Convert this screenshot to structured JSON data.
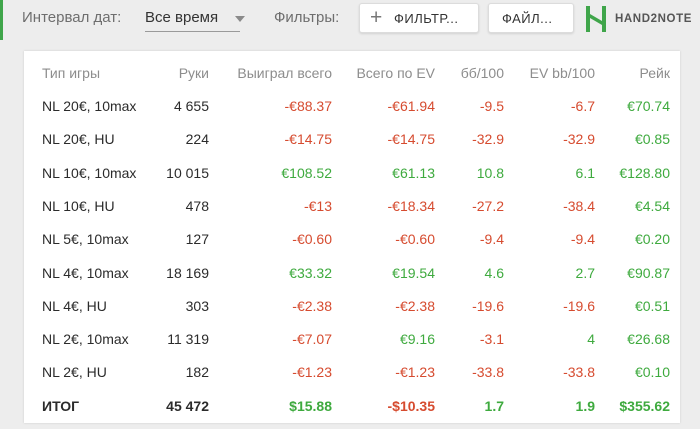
{
  "topbar": {
    "interval_label": "Интервал дат:",
    "interval_value": "Все время",
    "filters_label": "Фильтры:",
    "filter_button": "ФИЛЬТР...",
    "file_button": "ФАЙЛ...",
    "logo_text": "HAND2NOTE"
  },
  "table": {
    "headers": [
      "Тип игры",
      "Руки",
      "Выиграл всего",
      "Всего по EV",
      "бб/100",
      "EV bb/100",
      "Рейк"
    ],
    "rows": [
      [
        "NL 20€, 10max",
        "4 655",
        "-€88.37",
        "-€61.94",
        "-9.5",
        "-6.7",
        "€70.74"
      ],
      [
        "NL 20€, HU",
        "224",
        "-€14.75",
        "-€14.75",
        "-32.9",
        "-32.9",
        "€0.85"
      ],
      [
        "NL 10€, 10max",
        "10 015",
        "€108.52",
        "€61.13",
        "10.8",
        "6.1",
        "€128.80"
      ],
      [
        "NL 10€, HU",
        "478",
        "-€13",
        "-€18.34",
        "-27.2",
        "-38.4",
        "€4.54"
      ],
      [
        "NL 5€, 10max",
        "127",
        "-€0.60",
        "-€0.60",
        "-9.4",
        "-9.4",
        "€0.20"
      ],
      [
        "NL 4€, 10max",
        "18 169",
        "€33.32",
        "€19.54",
        "4.6",
        "2.7",
        "€90.87"
      ],
      [
        "NL 4€, HU",
        "303",
        "-€2.38",
        "-€2.38",
        "-19.6",
        "-19.6",
        "€0.51"
      ],
      [
        "NL 2€, 10max",
        "11 319",
        "-€7.07",
        "€9.16",
        "-3.1",
        "4",
        "€26.68"
      ],
      [
        "NL 2€, HU",
        "182",
        "-€1.23",
        "-€1.23",
        "-33.8",
        "-33.8",
        "€0.10"
      ]
    ],
    "total": [
      "ИТОГ",
      "45 472",
      "$15.88",
      "-$10.35",
      "1.7",
      "1.9",
      "$355.62"
    ]
  },
  "colors": {
    "positive": "#3eaa3e",
    "negative": "#d64b2f",
    "brand": "#3fa54a"
  }
}
